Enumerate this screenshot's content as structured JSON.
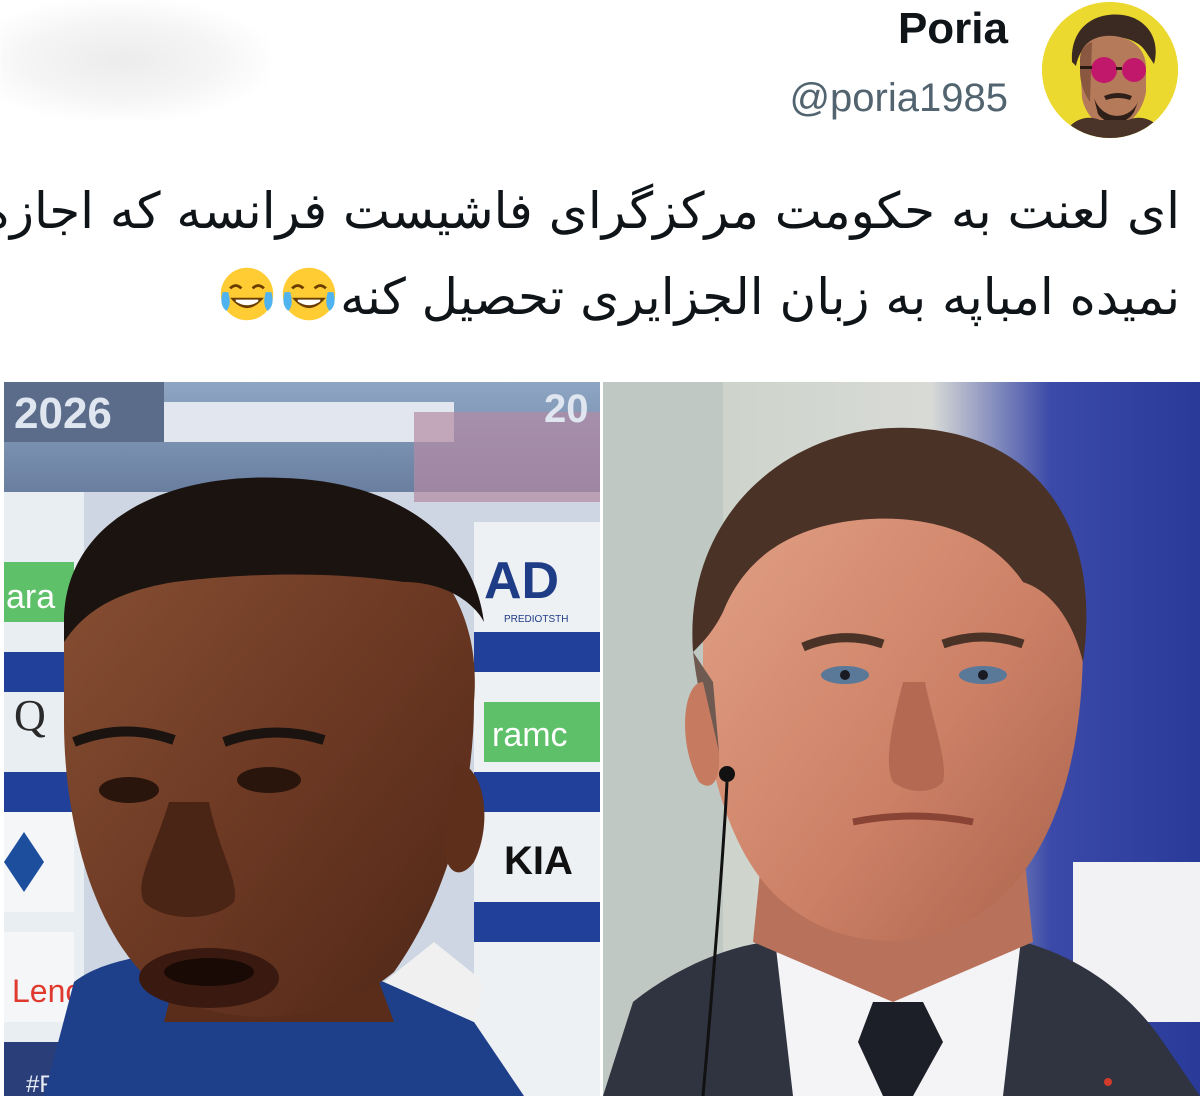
{
  "tweet": {
    "display_name": "Poria",
    "handle": "@poria1985",
    "text_line_1": "ای لعنت به حکومت مرکزگرای فاشیست فرانسه که اجازه",
    "text_line_2": "نمیده امباپه به زبان الجزایری تحصیل کنه",
    "emoji_name": "face-with-tears-of-joy",
    "emoji_count": 2
  },
  "avatar": {
    "icon": "avatar-man-sunglasses",
    "background_color": "#e8d92a"
  },
  "photo_left": {
    "description_icon": "footballer-interview-photo",
    "overlay_texts": [
      "2026",
      "20",
      "AD",
      "PREDIOTSTH",
      "ara",
      "Q",
      "ramc",
      "Lenc",
      "#FIFAW",
      "KIA"
    ]
  },
  "photo_right": {
    "description_icon": "politician-portrait-photo"
  },
  "colors": {
    "text_primary": "#0f1419",
    "text_secondary": "#536471"
  }
}
